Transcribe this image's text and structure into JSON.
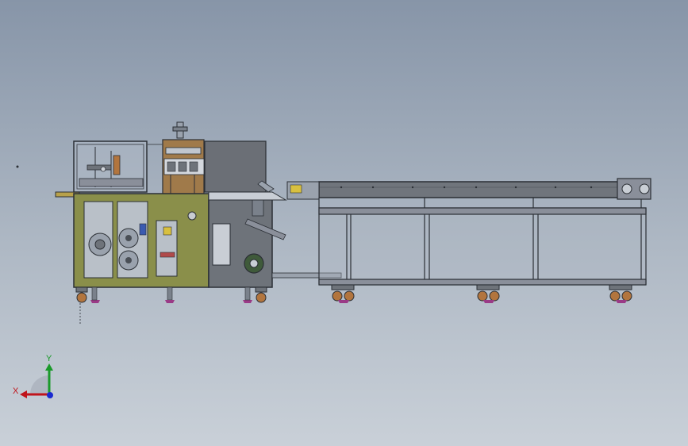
{
  "viewport": {
    "triad": {
      "x_label": "X",
      "y_label": "Y"
    }
  },
  "model": {
    "colors": {
      "frame_olive": "#8a8f4a",
      "frame_gray": "#6e737a",
      "conveyor_gray": "#70757c",
      "outline": "#2b2f35",
      "guard_glass": "#aeb8c4",
      "hopper": "#6b6f76",
      "copper": "#b2753e",
      "caster_purple": "#9a3a86",
      "axis_x": "#c0141b",
      "axis_y": "#1a9a2a",
      "axis_z": "#1a2ad0"
    }
  }
}
